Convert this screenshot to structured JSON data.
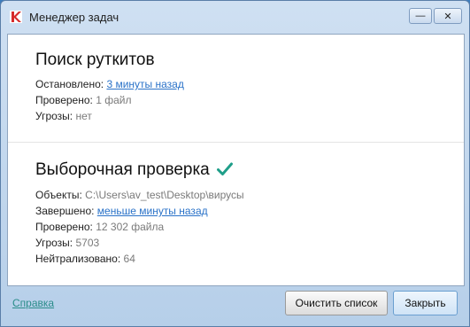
{
  "window": {
    "title": "Менеджер задач",
    "minimize_glyph": "—",
    "close_glyph": "✕",
    "app_icon": "kaspersky-k-icon"
  },
  "rootkit_scan": {
    "title": "Поиск руткитов",
    "stopped_label": "Остановлено:",
    "stopped_value": "3 минуты назад",
    "checked_label": "Проверено:",
    "checked_value": "1 файл",
    "threats_label": "Угрозы:",
    "threats_value": "нет"
  },
  "custom_scan": {
    "title": "Выборочная проверка",
    "status_icon": "checkmark-icon",
    "objects_label": "Объекты:",
    "objects_value": "C:\\Users\\av_test\\Desktop\\вирусы",
    "finished_label": "Завершено:",
    "finished_value": "меньше минуты назад",
    "checked_label": "Проверено:",
    "checked_value": "12 302 файла",
    "threats_label": "Угрозы:",
    "threats_value": "5703",
    "neutralized_label": "Нейтрализовано:",
    "neutralized_value": "64"
  },
  "footer": {
    "help_label": "Справка",
    "clear_label": "Очистить список",
    "close_label": "Закрыть"
  },
  "colors": {
    "link": "#2a72c8",
    "help_link": "#2a8c8a",
    "check": "#1f9e89"
  }
}
